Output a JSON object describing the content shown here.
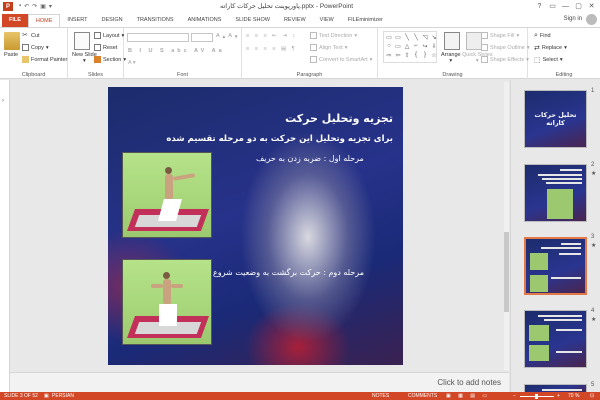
{
  "app": {
    "title": "پاورپوینت تحلیل حرکات کاراته.pptx - PowerPoint",
    "window_controls": [
      "?",
      "▭",
      "—",
      "▢",
      "✕"
    ]
  },
  "tabs": [
    "FILE",
    "HOME",
    "INSERT",
    "DESIGN",
    "TRANSITIONS",
    "ANIMATIONS",
    "SLIDE SHOW",
    "REVIEW",
    "VIEW",
    "FILEminimizer"
  ],
  "signin": "Sign in",
  "ribbon": {
    "clipboard": {
      "paste": "Paste",
      "cut": "Cut",
      "copy": "Copy",
      "format_painter": "Format Painter",
      "label": "Clipboard"
    },
    "slides": {
      "new_slide": "New Slide",
      "layout": "Layout",
      "reset": "Reset",
      "section": "Section",
      "label": "Slides"
    },
    "font": {
      "label": "Font"
    },
    "paragraph": {
      "text_direction": "Text Direction",
      "align_text": "Align Text",
      "convert_smartart": "Convert to SmartArt",
      "label": "Paragraph"
    },
    "drawing": {
      "arrange": "Arrange",
      "quick_styles": "Quick Styles",
      "shape_fill": "Shape Fill",
      "shape_outline": "Shape Outline",
      "shape_effects": "Shape Effects",
      "label": "Drawing"
    },
    "editing": {
      "find": "Find",
      "replace": "Replace",
      "select": "Select",
      "label": "Editing"
    }
  },
  "slide": {
    "title": "تجزیه وتحلیل حرکت",
    "subtitle": "برای تجزیه وتحلیل این حرکت به دو مرحله تقسیم شده",
    "step1": "مرحله اول :  ضربه زدن به حریف",
    "step2": "مرحله دوم :  حرکت برگشت به وضعیت شروع"
  },
  "thumbnails": [
    {
      "num": "1",
      "title": "تحلیل حرکات کاراته"
    },
    {
      "num": "2",
      "star": "★"
    },
    {
      "num": "3",
      "star": "★"
    },
    {
      "num": "4",
      "star": "★"
    },
    {
      "num": "5"
    }
  ],
  "notes_placeholder": "Click to add notes",
  "statusbar": {
    "slide_info": "SLIDE 3 OF 52",
    "language": "PERSIAN",
    "notes": "NOTES",
    "comments": "COMMENTS",
    "zoom": "70 %"
  },
  "colors": {
    "accent": "#d24726",
    "tab_text_active": "#c43e1c",
    "slide_bg": "#1f2d75"
  }
}
